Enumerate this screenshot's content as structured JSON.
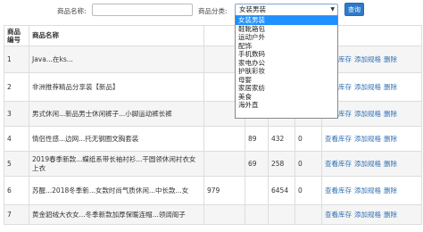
{
  "search": {
    "name_label": "商品名称:",
    "category_label": "商品分类:",
    "category_value": "女装男装",
    "query_button": "查询"
  },
  "dropdown": {
    "options": [
      "女装男装",
      "鞋靴箱包",
      "运动户外",
      "配饰",
      "手机数码",
      "家电办公",
      "护肤彩妆",
      "母婴",
      "家居家纺",
      "美食",
      "海外直"
    ]
  },
  "table": {
    "headers": [
      "商品\n编号",
      "商品名称",
      "",
      "",
      "",
      "",
      "操作"
    ],
    "op_labels": {
      "view_stock": "查看库存",
      "add_spec": "添加规格",
      "delete": "删除"
    },
    "rows": [
      {
        "id": "1",
        "name": "Java...在ks...",
        "c1": "",
        "c2": "",
        "c3": "",
        "c4": ""
      },
      {
        "id": "2",
        "name": "非洲推荐精品分享装【新品】",
        "c1": "",
        "c2": "",
        "c3": "",
        "c4": ""
      },
      {
        "id": "3",
        "name": "男式休闲...新品男士休闲裤子...小脚运动裤长裤",
        "c1": "",
        "c2": "",
        "c3": "",
        "c4": ""
      },
      {
        "id": "4",
        "name": "情侣性感...边网...托无钢圈文胸套装",
        "c1": "",
        "c2": "89",
        "c3": "432",
        "c4": "0"
      },
      {
        "id": "5",
        "name": "2019春季新款...蝶纸系带长袖衬衫...干圆领休闲衬衣女上衣",
        "c1": "",
        "c2": "69",
        "c3": "258",
        "c4": "0"
      },
      {
        "id": "6",
        "name": "苏醒...2018冬季新...女款时尚气质休闲...中长款...女",
        "c1": "979",
        "c2": "",
        "c3": "6454",
        "c4": "0"
      },
      {
        "id": "7",
        "name": "黄金貂绒大衣女...冬季新款加厚保暖连帽...领阔阁子",
        "c1": "",
        "c2": "",
        "c3": "",
        "c4": ""
      }
    ]
  },
  "colors": {
    "accent": "#2f79c8",
    "link": "#2f6fb3",
    "selected": "#1e90ff"
  }
}
